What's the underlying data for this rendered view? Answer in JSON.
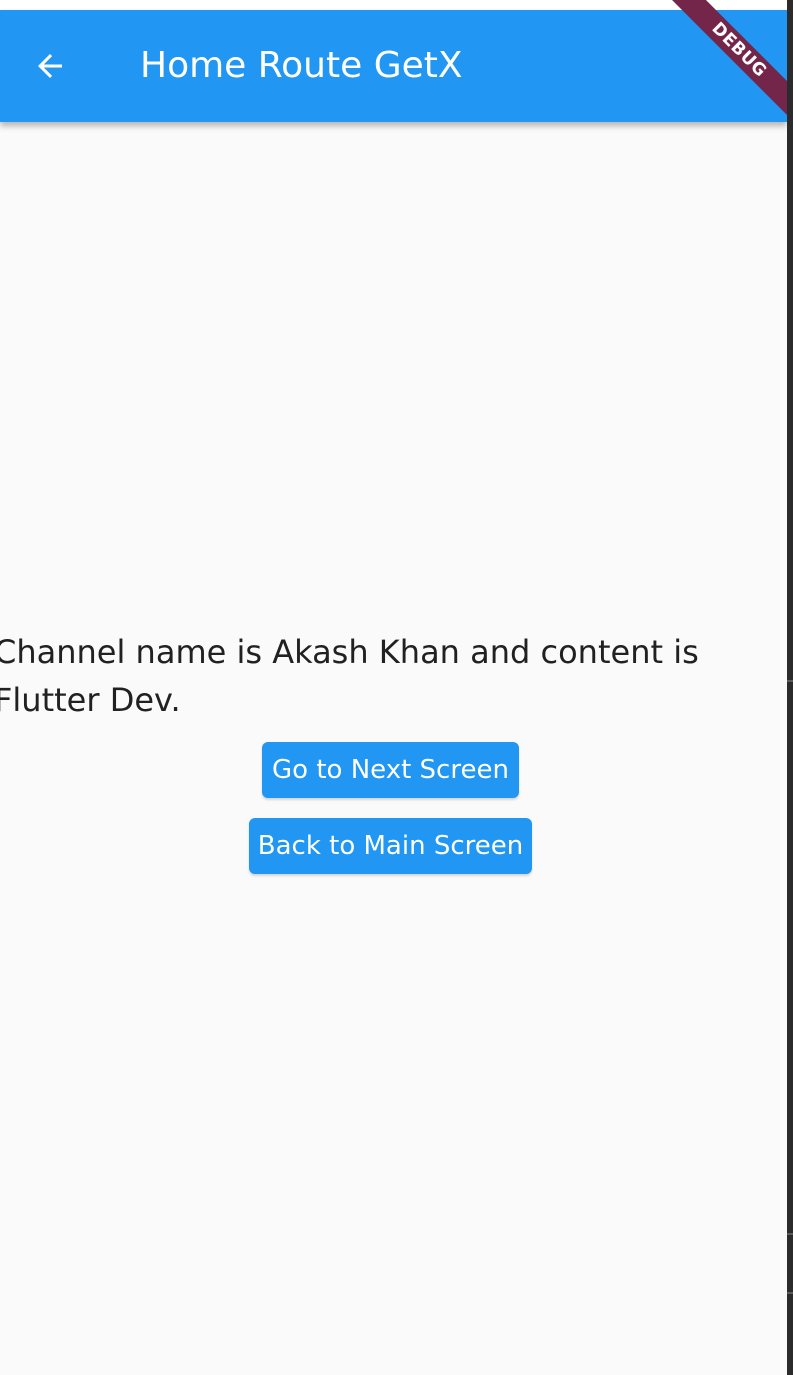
{
  "app_bar": {
    "title": "Home Route GetX",
    "back_icon": "arrow-back-icon",
    "background": "#2196f3"
  },
  "debug_banner": {
    "label": "DEBUG",
    "color": "#74264a"
  },
  "main": {
    "message": "Channel name is Akash Khan and content is Flutter Dev.",
    "next_button_label": "Go to Next Screen",
    "back_button_label": "Back to Main Screen",
    "button_color": "#2196f3"
  }
}
